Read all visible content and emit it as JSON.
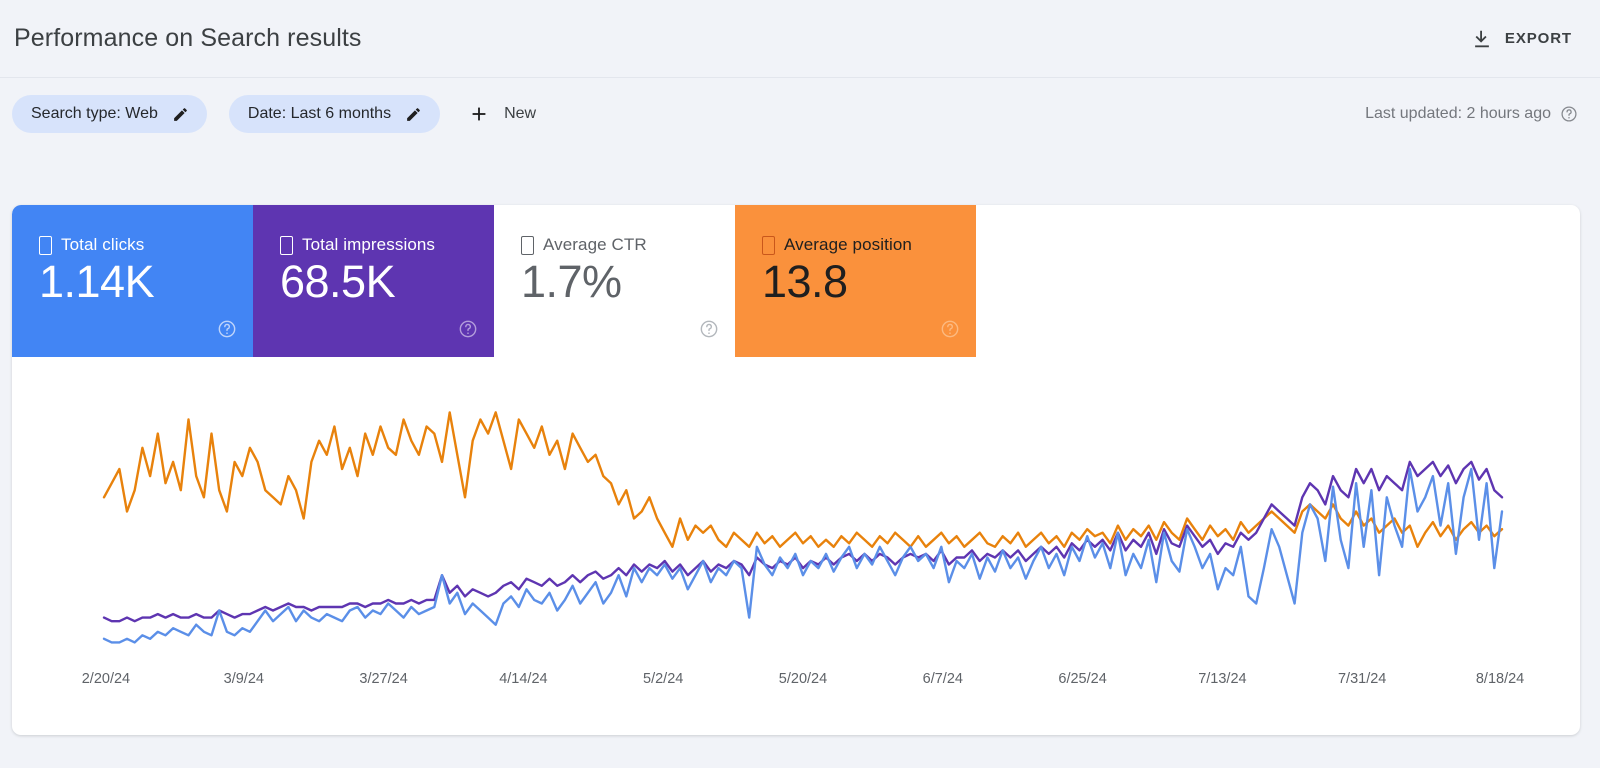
{
  "header": {
    "title": "Performance on Search results",
    "export_label": "EXPORT",
    "export_icon": "download-icon"
  },
  "filters": {
    "chips": [
      {
        "label": "Search type: Web",
        "icon": "pencil-icon"
      },
      {
        "label": "Date: Last 6 months",
        "icon": "pencil-icon"
      }
    ],
    "new_label": "New",
    "new_icon": "plus-icon",
    "last_updated": "Last updated: 2 hours ago",
    "help_icon": "help-circle-icon"
  },
  "metrics": [
    {
      "label": "Total clicks",
      "value": "1.14K",
      "color": "#4285F4",
      "selected": true,
      "icon": "checkbox-checked-icon",
      "help_icon": "help-circle-icon"
    },
    {
      "label": "Total impressions",
      "value": "68.5K",
      "color": "#5E35B1",
      "selected": true,
      "icon": "checkbox-checked-icon",
      "help_icon": "help-circle-icon"
    },
    {
      "label": "Average CTR",
      "value": "1.7%",
      "color": "#FFFFFF",
      "selected": false,
      "icon": "checkbox-unchecked-icon",
      "help_icon": "help-circle-icon"
    },
    {
      "label": "Average position",
      "value": "13.8",
      "color": "#FA913C",
      "selected": true,
      "icon": "checkbox-checked-icon",
      "help_icon": "help-circle-icon"
    }
  ],
  "chart_data": {
    "type": "line",
    "title": "Performance on Search results",
    "xlabel": "",
    "ylabel": "",
    "grid": false,
    "legend": "none",
    "x_tick_labels": [
      "2/20/24",
      "3/9/24",
      "3/27/24",
      "4/14/24",
      "5/2/24",
      "5/20/24",
      "6/7/24",
      "6/25/24",
      "7/13/24",
      "7/31/24",
      "8/18/24"
    ],
    "x_tick_positions": [
      0,
      18,
      36,
      54,
      72,
      90,
      108,
      126,
      144,
      162,
      180
    ],
    "x_range": [
      0,
      180
    ],
    "series": [
      {
        "name": "Total clicks",
        "color": "#5B8FE8",
        "values": [
          4,
          3,
          3,
          4,
          3,
          5,
          4,
          6,
          5,
          7,
          6,
          5,
          8,
          6,
          5,
          12,
          6,
          5,
          7,
          6,
          9,
          12,
          9,
          11,
          13,
          9,
          12,
          10,
          9,
          11,
          10,
          9,
          12,
          13,
          10,
          12,
          11,
          14,
          12,
          10,
          13,
          11,
          12,
          13,
          22,
          14,
          17,
          11,
          14,
          12,
          10,
          8,
          14,
          16,
          13,
          18,
          15,
          14,
          17,
          12,
          15,
          19,
          14,
          17,
          20,
          14,
          17,
          22,
          16,
          24,
          20,
          24,
          22,
          25,
          21,
          24,
          18,
          22,
          26,
          20,
          24,
          22,
          26,
          24,
          10,
          30,
          25,
          22,
          27,
          24,
          28,
          22,
          26,
          24,
          28,
          23,
          27,
          30,
          24,
          28,
          25,
          30,
          26,
          22,
          27,
          30,
          26,
          28,
          24,
          30,
          20,
          26,
          24,
          28,
          21,
          27,
          23,
          29,
          24,
          27,
          21,
          26,
          30,
          24,
          28,
          22,
          30,
          26,
          33,
          27,
          31,
          24,
          34,
          22,
          28,
          24,
          32,
          20,
          34,
          26,
          23,
          35,
          30,
          24,
          28,
          18,
          24,
          22,
          30,
          16,
          14,
          24,
          35,
          30,
          22,
          14,
          34,
          42,
          38,
          26,
          47,
          32,
          24,
          48,
          30,
          46,
          22,
          44,
          36,
          30,
          52,
          40,
          44,
          50,
          36,
          48,
          28,
          44,
          52,
          32,
          48,
          24,
          40
        ]
      },
      {
        "name": "Total impressions",
        "color": "#5E35B1",
        "values": [
          10,
          9,
          9,
          10,
          9,
          10,
          10,
          11,
          10,
          11,
          10,
          10,
          11,
          10,
          10,
          12,
          11,
          10,
          11,
          11,
          12,
          13,
          12,
          13,
          14,
          13,
          13,
          12,
          13,
          13,
          13,
          13,
          14,
          14,
          13,
          14,
          14,
          15,
          14,
          14,
          15,
          14,
          15,
          15,
          22,
          17,
          19,
          16,
          18,
          17,
          16,
          17,
          19,
          20,
          18,
          21,
          20,
          19,
          21,
          19,
          20,
          22,
          20,
          22,
          23,
          21,
          22,
          24,
          22,
          25,
          23,
          25,
          24,
          26,
          23,
          25,
          22,
          24,
          26,
          23,
          25,
          24,
          26,
          25,
          22,
          27,
          25,
          24,
          26,
          25,
          27,
          24,
          26,
          25,
          27,
          25,
          27,
          28,
          26,
          28,
          26,
          28,
          27,
          25,
          27,
          28,
          27,
          28,
          26,
          29,
          25,
          27,
          27,
          29,
          26,
          28,
          27,
          29,
          27,
          29,
          26,
          28,
          30,
          28,
          30,
          27,
          31,
          29,
          32,
          30,
          32,
          29,
          34,
          29,
          32,
          30,
          34,
          28,
          35,
          31,
          30,
          36,
          33,
          30,
          32,
          28,
          31,
          30,
          34,
          32,
          34,
          38,
          42,
          40,
          38,
          36,
          44,
          48,
          46,
          42,
          50,
          46,
          44,
          52,
          48,
          52,
          46,
          50,
          48,
          46,
          54,
          50,
          52,
          54,
          50,
          53,
          48,
          52,
          54,
          49,
          52,
          46,
          44
        ]
      },
      {
        "name": "Average position",
        "color": "#E8820C",
        "values": [
          44,
          48,
          52,
          40,
          46,
          58,
          50,
          62,
          48,
          54,
          46,
          66,
          50,
          44,
          62,
          46,
          40,
          54,
          50,
          58,
          54,
          46,
          44,
          42,
          50,
          46,
          38,
          54,
          60,
          56,
          64,
          52,
          58,
          50,
          62,
          56,
          64,
          58,
          56,
          66,
          60,
          56,
          64,
          62,
          54,
          68,
          56,
          44,
          60,
          66,
          62,
          68,
          60,
          52,
          66,
          62,
          58,
          64,
          56,
          60,
          52,
          62,
          58,
          54,
          56,
          50,
          48,
          42,
          46,
          38,
          40,
          44,
          38,
          34,
          30,
          38,
          32,
          36,
          34,
          36,
          32,
          30,
          34,
          32,
          30,
          34,
          31,
          33,
          30,
          32,
          34,
          31,
          33,
          30,
          32,
          30,
          33,
          31,
          34,
          32,
          30,
          33,
          31,
          34,
          32,
          30,
          33,
          30,
          32,
          34,
          31,
          33,
          30,
          32,
          34,
          31,
          30,
          33,
          31,
          34,
          30,
          32,
          34,
          31,
          33,
          30,
          34,
          32,
          35,
          33,
          34,
          31,
          36,
          32,
          35,
          33,
          36,
          32,
          37,
          34,
          32,
          38,
          35,
          32,
          36,
          33,
          35,
          32,
          37,
          34,
          36,
          38,
          40,
          38,
          36,
          34,
          40,
          42,
          40,
          38,
          42,
          38,
          36,
          40,
          36,
          38,
          34,
          36,
          38,
          34,
          36,
          30,
          34,
          37,
          33,
          36,
          32,
          35,
          37,
          34,
          36,
          33,
          35
        ]
      }
    ]
  }
}
